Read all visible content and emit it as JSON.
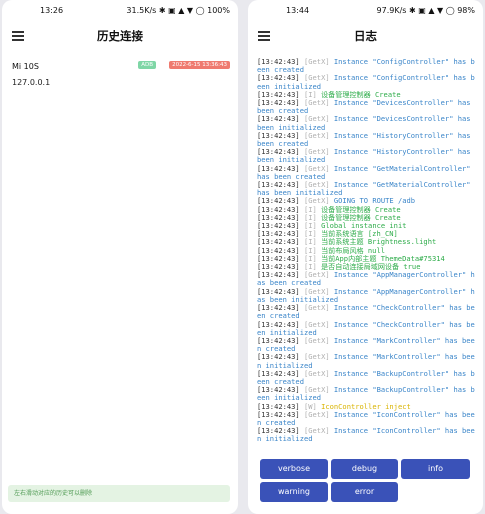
{
  "left_screen": {
    "status": {
      "time": "13:26",
      "right": "31.5K/s ✱ ▣ ▲ ▼ ◯ 100%"
    },
    "title": "历史连接",
    "device": {
      "name": "Mi 10S",
      "ip": "127.0.0.1",
      "badge_green": "ADB",
      "badge_red": "2022-6-15 13:36:43"
    },
    "hint": "左右滑动对应的历史可以删除"
  },
  "right_screen": {
    "status": {
      "time": "13:44",
      "right": "97.9K/s ✱ ▣ ▲ ▼ ◯ 98%"
    },
    "title": "日志",
    "log": [
      {
        "time": "[13:42:43]",
        "tag": "[GetX]",
        "msg": "Instance \"ConfigController\" has been created",
        "type": "debug"
      },
      {
        "time": "[13:42:43]",
        "tag": "[GetX]",
        "msg": "Instance \"ConfigController\" has been initialized",
        "type": "debug"
      },
      {
        "time": "[13:42:43]",
        "tag": "[I]",
        "msg": "设备管理控制器 Create",
        "type": "info"
      },
      {
        "time": "[13:42:43]",
        "tag": "[GetX]",
        "msg": "Instance \"DevicesController\" has been created",
        "type": "debug"
      },
      {
        "time": "[13:42:43]",
        "tag": "[GetX]",
        "msg": "Instance \"DevicesController\" has been initialized",
        "type": "debug"
      },
      {
        "time": "[13:42:43]",
        "tag": "[GetX]",
        "msg": "Instance \"HistoryController\" has been created",
        "type": "debug"
      },
      {
        "time": "[13:42:43]",
        "tag": "[GetX]",
        "msg": "Instance \"HistoryController\" has been initialized",
        "type": "debug"
      },
      {
        "time": "[13:42:43]",
        "tag": "[GetX]",
        "msg": "Instance \"GetMaterialController\" has been created",
        "type": "debug"
      },
      {
        "time": "[13:42:43]",
        "tag": "[GetX]",
        "msg": "Instance \"GetMaterialController\" has been initialized",
        "type": "debug"
      },
      {
        "time": "[13:42:43]",
        "tag": "[GetX]",
        "msg": "GOING TO ROUTE /adb",
        "type": "debug"
      },
      {
        "time": "[13:42:43]",
        "tag": "[I]",
        "msg": "设备管理控制器 Create",
        "type": "info"
      },
      {
        "time": "[13:42:43]",
        "tag": "[I]",
        "msg": "设备管理控制器 Create",
        "type": "info"
      },
      {
        "time": "[13:42:43]",
        "tag": "[I]",
        "msg": "Global instance init",
        "type": "info"
      },
      {
        "time": "[13:42:43]",
        "tag": "[I]",
        "msg": "当前系统语言 [zh_CN]",
        "type": "info"
      },
      {
        "time": "[13:42:43]",
        "tag": "[I]",
        "msg": "当前系统主题 Brightness.light",
        "type": "info"
      },
      {
        "time": "[13:42:43]",
        "tag": "[I]",
        "msg": "当前布局风格 null",
        "type": "info"
      },
      {
        "time": "[13:42:43]",
        "tag": "[I]",
        "msg": "当前App内部主题 ThemeData#75314",
        "type": "info"
      },
      {
        "time": "[13:42:43]",
        "tag": "[I]",
        "msg": "是否自动连接局域网设备 true",
        "type": "info"
      },
      {
        "time": "[13:42:43]",
        "tag": "[GetX]",
        "msg": "Instance \"AppManagerController\" has been created",
        "type": "debug"
      },
      {
        "time": "[13:42:43]",
        "tag": "[GetX]",
        "msg": "Instance \"AppManagerController\" has been initialized",
        "type": "debug"
      },
      {
        "time": "[13:42:43]",
        "tag": "[GetX]",
        "msg": "Instance \"CheckController\" has been created",
        "type": "debug"
      },
      {
        "time": "[13:42:43]",
        "tag": "[GetX]",
        "msg": "Instance \"CheckController\" has been initialized",
        "type": "debug"
      },
      {
        "time": "[13:42:43]",
        "tag": "[GetX]",
        "msg": "Instance \"MarkController\" has been created",
        "type": "debug"
      },
      {
        "time": "[13:42:43]",
        "tag": "[GetX]",
        "msg": "Instance \"MarkController\" has been initialized",
        "type": "debug"
      },
      {
        "time": "[13:42:43]",
        "tag": "[GetX]",
        "msg": "Instance \"BackupController\" has been created",
        "type": "debug"
      },
      {
        "time": "[13:42:43]",
        "tag": "[GetX]",
        "msg": "Instance \"BackupController\" has been initialized",
        "type": "debug"
      },
      {
        "time": "[13:42:43]",
        "tag": "[W]",
        "msg": "IconController inject",
        "type": "warn"
      },
      {
        "time": "[13:42:43]",
        "tag": "[GetX]",
        "msg": "Instance \"IconController\" has been created",
        "type": "debug"
      },
      {
        "time": "[13:42:43]",
        "tag": "[GetX]",
        "msg": "Instance \"IconController\" has been initialized",
        "type": "debug"
      }
    ],
    "buttons": {
      "verbose": "verbose",
      "debug": "debug",
      "info": "info",
      "warning": "warning",
      "error": "error"
    }
  },
  "colors": {
    "button": "#3a52b8",
    "debug": "#3a85c9",
    "info": "#2eac4a",
    "warn": "#d9b400",
    "badge_green": "#7fd6a6",
    "badge_red": "#ef7a6f"
  },
  "icons": [
    "menu-icon"
  ]
}
